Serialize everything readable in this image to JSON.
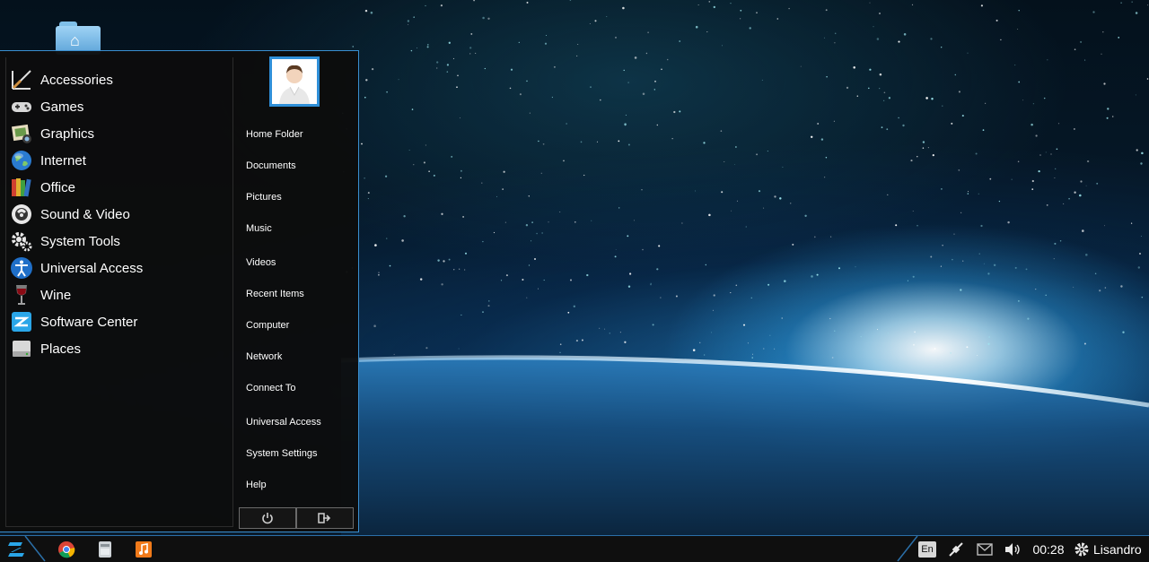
{
  "desktop": {
    "folder_icon": "home-folder-icon"
  },
  "menu": {
    "categories": [
      {
        "label": "Accessories",
        "icon": "accessories-icon"
      },
      {
        "label": "Games",
        "icon": "gamepad-icon"
      },
      {
        "label": "Graphics",
        "icon": "graphics-icon"
      },
      {
        "label": "Internet",
        "icon": "globe-icon"
      },
      {
        "label": "Office",
        "icon": "office-books-icon"
      },
      {
        "label": "Sound & Video",
        "icon": "media-icon"
      },
      {
        "label": "System Tools",
        "icon": "gear-icon"
      },
      {
        "label": "Universal Access",
        "icon": "accessibility-icon"
      },
      {
        "label": "Wine",
        "icon": "wine-glass-icon"
      },
      {
        "label": "Software Center",
        "icon": "software-center-icon"
      },
      {
        "label": "Places",
        "icon": "drive-icon"
      }
    ],
    "places": [
      "Home Folder",
      "Documents",
      "Pictures",
      "Music",
      "Videos",
      "Recent Items",
      "Computer",
      "Network",
      "Connect To",
      "Universal Access",
      "System Settings",
      "Help"
    ],
    "buttons": {
      "power": "power-icon",
      "logout": "logout-icon"
    }
  },
  "taskbar": {
    "launchers": [
      "chrome-icon",
      "file-manager-icon",
      "music-player-icon"
    ],
    "language": "En",
    "clock": "00:28",
    "user": "Lisandro",
    "tray_icons": [
      "network-icon",
      "mail-icon",
      "volume-icon",
      "settings-gear-icon"
    ]
  },
  "colors": {
    "accent": "#2f8fd8",
    "menu_bg": "#0c0c0c",
    "taskbar_bg": "#0f0f0f"
  }
}
